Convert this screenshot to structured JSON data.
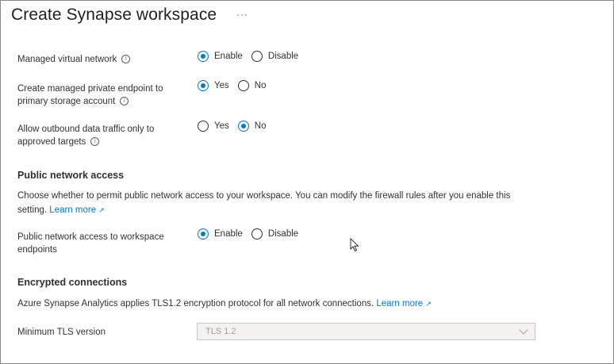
{
  "header": {
    "title": "Create Synapse workspace",
    "more": "···"
  },
  "settings": [
    {
      "label_lines": [
        "Managed virtual network"
      ],
      "options": [
        "Enable",
        "Disable"
      ],
      "selected": "Enable"
    },
    {
      "label_lines": [
        "Create managed private endpoint to",
        "primary storage account"
      ],
      "options": [
        "Yes",
        "No"
      ],
      "selected": "Yes"
    },
    {
      "label_lines": [
        "Allow outbound data traffic only to",
        "approved targets"
      ],
      "options": [
        "Yes",
        "No"
      ],
      "selected": "No"
    }
  ],
  "public_network": {
    "heading": "Public network access",
    "description": "Choose whether to permit public network access to your workspace. You can modify the firewall rules after you enable this",
    "description_2": "setting.",
    "learn_more": "Learn more",
    "setting_label_lines": [
      "Public network access to workspace",
      "endpoints"
    ],
    "options": [
      "Enable",
      "Disable"
    ],
    "selected": "Enable"
  },
  "encryption": {
    "heading": "Encrypted connections",
    "description": "Azure Synapse Analytics applies TLS1.2 encryption protocol for all network connections.",
    "learn_more": "Learn more",
    "tls_label": "Minimum TLS version",
    "tls_value": "TLS 1.2"
  },
  "colors": {
    "accent": "#0078d4",
    "text": "#323130",
    "disabled_bg": "#f3f2f1"
  },
  "icons": {
    "info": "info-icon",
    "external": "external-link-icon",
    "dropdown": "chevron-down-icon",
    "cursor": "mouse-pointer-icon"
  }
}
